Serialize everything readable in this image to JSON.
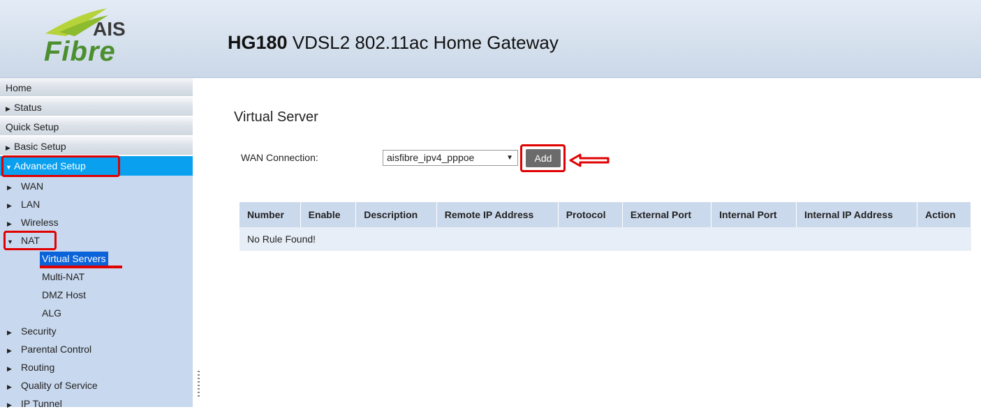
{
  "header": {
    "brand_top": "AIS",
    "brand_bottom": "Fibre",
    "model": "HG180",
    "subtitle": "VDSL2 802.11ac Home Gateway"
  },
  "sidebar": {
    "home": "Home",
    "status": "Status",
    "quick_setup": "Quick Setup",
    "basic_setup": "Basic Setup",
    "advanced_setup": "Advanced Setup",
    "sub": {
      "wan": "WAN",
      "lan": "LAN",
      "wireless": "Wireless",
      "nat": "NAT",
      "nat_items": [
        "Virtual Servers",
        "Multi-NAT",
        "DMZ Host",
        "ALG"
      ],
      "security": "Security",
      "parental": "Parental Control",
      "routing": "Routing",
      "qos": "Quality of Service",
      "ip_tunnel": "IP Tunnel"
    }
  },
  "main": {
    "heading": "Virtual Server",
    "wan_label": "WAN Connection:",
    "wan_value": "aisfibre_ipv4_pppoe",
    "add_label": "Add",
    "columns": [
      "Number",
      "Enable",
      "Description",
      "Remote IP Address",
      "Protocol",
      "External Port",
      "Internal Port",
      "Internal IP Address",
      "Action"
    ],
    "empty_text": "No Rule Found!"
  },
  "colors": {
    "active_nav": "#0aa0f0",
    "selected_item": "#0a63d8",
    "annotation_red": "#e00000",
    "logo_green": "#4c8f2f"
  }
}
